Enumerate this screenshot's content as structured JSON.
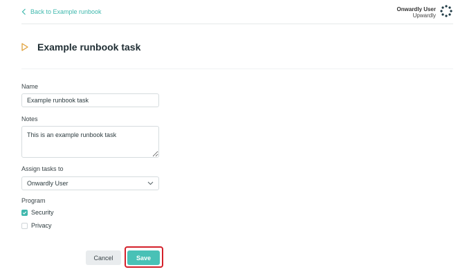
{
  "nav": {
    "back_label": "Back to Example runbook",
    "user_name": "Onwardly User",
    "user_org": "Upwardly"
  },
  "header": {
    "title": "Example runbook task"
  },
  "form": {
    "name_label": "Name",
    "name_value": "Example runbook task",
    "notes_label": "Notes",
    "notes_value": "This is an example runbook task",
    "assign_label": "Assign tasks to",
    "assign_value": "Onwardly User",
    "program_label": "Program",
    "programs": [
      {
        "label": "Security",
        "checked": true
      },
      {
        "label": "Privacy",
        "checked": false
      }
    ]
  },
  "actions": {
    "cancel_label": "Cancel",
    "save_label": "Save"
  },
  "colors": {
    "accent": "#3fb8ad",
    "play_icon": "#e0a13a",
    "highlight": "#d4202a"
  },
  "icons": {
    "back": "chevron-left-icon",
    "logo": "dotted-ring-logo",
    "task": "play-outline-icon",
    "select": "chevron-down-icon",
    "check": "check-icon"
  }
}
